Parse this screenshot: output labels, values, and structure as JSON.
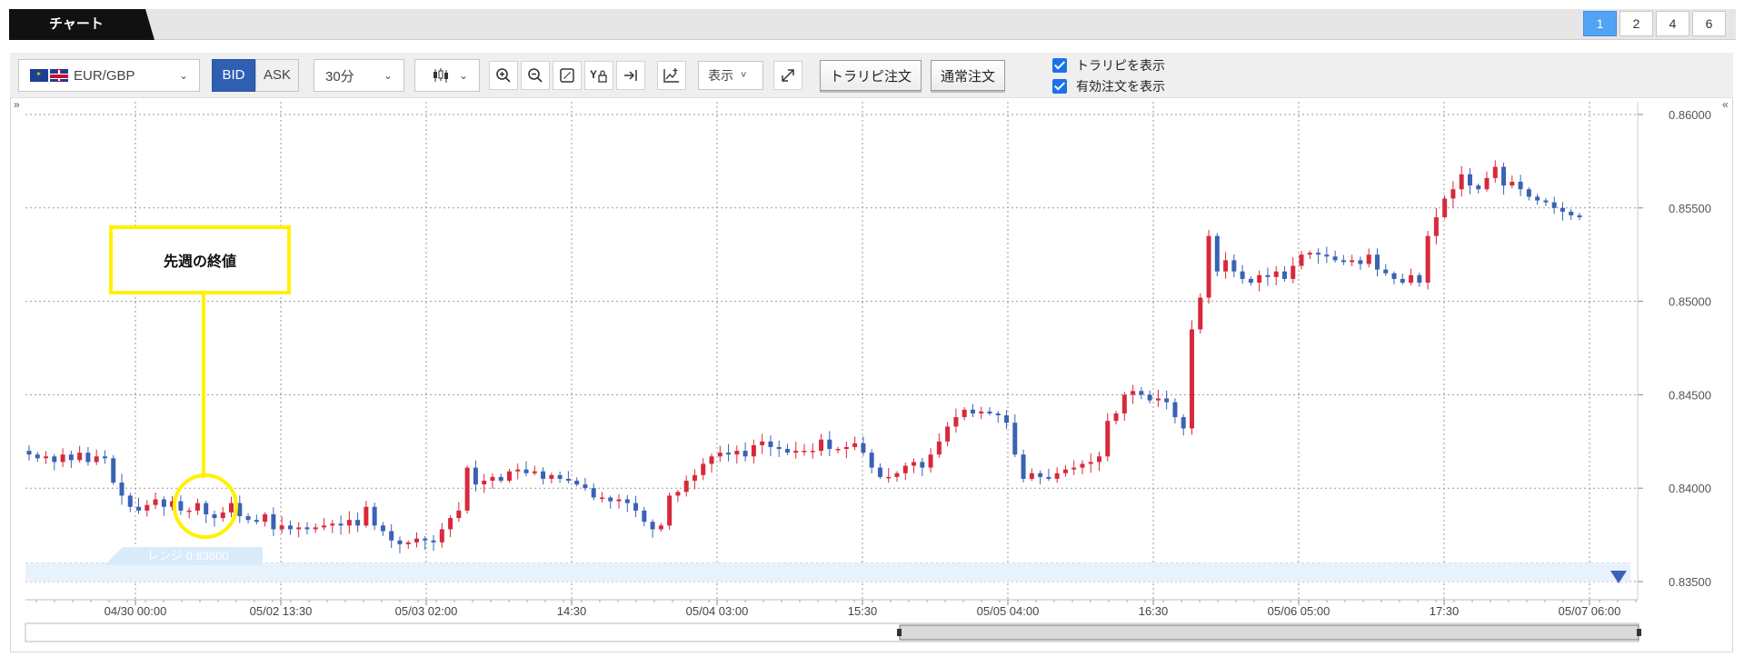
{
  "header": {
    "tab_label": "チャート",
    "layouts": [
      {
        "label": "1",
        "active": true
      },
      {
        "label": "2",
        "active": false
      },
      {
        "label": "4",
        "active": false
      },
      {
        "label": "6",
        "active": false
      }
    ]
  },
  "toolbar": {
    "pair": "EUR/GBP",
    "bid_label": "BID",
    "ask_label": "ASK",
    "timeframe": "30分",
    "display_label": "表示",
    "trap_repeat_order_label": "トラリピ注文",
    "normal_order_label": "通常注文",
    "show_trap_repeat_label": "トラリピを表示",
    "show_active_orders_label": "有効注文を表示",
    "show_trap_repeat_checked": true,
    "show_active_orders_checked": true
  },
  "annotation": {
    "label": "先週の終値",
    "color": "#fff200"
  },
  "range_tag": "レンジ 0.83600",
  "colors": {
    "up": "#d8293c",
    "down": "#3a62b5",
    "bid_active": "#2f5fb3",
    "layout_active": "#52a3f4"
  },
  "chart_data": {
    "type": "candlestick",
    "instrument": "EUR/GBP",
    "price": "BID",
    "interval": "30分",
    "y_ticks": [
      "0.86000",
      "0.85500",
      "0.85000",
      "0.84500",
      "0.84000",
      "0.83500"
    ],
    "ylim": [
      0.835,
      0.86
    ],
    "x_ticks": [
      "04/30 00:00",
      "05/02 13:30",
      "05/03 02:00",
      "14:30",
      "05/04 03:00",
      "15:30",
      "05/05 04:00",
      "16:30",
      "05/06 05:00",
      "17:30",
      "05/07 06:00"
    ],
    "grid": true,
    "range_band": [
      0.835,
      0.836
    ],
    "close_path": [
      0.8418,
      0.8416,
      0.8417,
      0.8414,
      0.8418,
      0.8415,
      0.8419,
      0.8414,
      0.8417,
      0.8416,
      0.8403,
      0.8396,
      0.839,
      0.8388,
      0.8391,
      0.8394,
      0.839,
      0.8393,
      0.8388,
      0.8388,
      0.8392,
      0.8386,
      0.8384,
      0.8387,
      0.8392,
      0.8385,
      0.8383,
      0.8382,
      0.8386,
      0.8378,
      0.838,
      0.8378,
      0.8379,
      0.8378,
      0.8379,
      0.838,
      0.8381,
      0.838,
      0.8383,
      0.838,
      0.839,
      0.838,
      0.8377,
      0.8372,
      0.837,
      0.8371,
      0.8373,
      0.8372,
      0.8371,
      0.8378,
      0.8384,
      0.8388,
      0.8411,
      0.8402,
      0.8404,
      0.8406,
      0.8404,
      0.8409,
      0.841,
      0.8408,
      0.8409,
      0.8405,
      0.8407,
      0.8405,
      0.8404,
      0.8402,
      0.84,
      0.8395,
      0.8395,
      0.8393,
      0.8394,
      0.8392,
      0.8388,
      0.8382,
      0.8378,
      0.838,
      0.8396,
      0.8398,
      0.8404,
      0.8407,
      0.8413,
      0.8417,
      0.8419,
      0.8418,
      0.842,
      0.8417,
      0.8423,
      0.8425,
      0.8422,
      0.8421,
      0.8419,
      0.842,
      0.842,
      0.842,
      0.8426,
      0.8421,
      0.8421,
      0.8422,
      0.8424,
      0.8419,
      0.8411,
      0.8406,
      0.8406,
      0.8408,
      0.8412,
      0.8414,
      0.8411,
      0.8418,
      0.8425,
      0.8433,
      0.8438,
      0.8442,
      0.844,
      0.8441,
      0.844,
      0.8439,
      0.8435,
      0.8418,
      0.8405,
      0.8408,
      0.8406,
      0.8405,
      0.8408,
      0.841,
      0.8411,
      0.8413,
      0.8414,
      0.8417,
      0.8436,
      0.844,
      0.845,
      0.8452,
      0.845,
      0.8447,
      0.8448,
      0.8446,
      0.8438,
      0.8432,
      0.8485,
      0.8502,
      0.8535,
      0.8516,
      0.8522,
      0.8516,
      0.8512,
      0.851,
      0.8514,
      0.8513,
      0.8516,
      0.8512,
      0.8519,
      0.8525,
      0.8526,
      0.8525,
      0.8524,
      0.8522,
      0.8521,
      0.8522,
      0.852,
      0.8525,
      0.8517,
      0.8515,
      0.8512,
      0.851,
      0.8514,
      0.851,
      0.8535,
      0.8545,
      0.8555,
      0.856,
      0.8568,
      0.8562,
      0.856,
      0.8566,
      0.8572,
      0.8562,
      0.8564,
      0.856,
      0.8556,
      0.8554,
      0.8553,
      0.855,
      0.8548,
      0.8546,
      0.8545
    ]
  }
}
